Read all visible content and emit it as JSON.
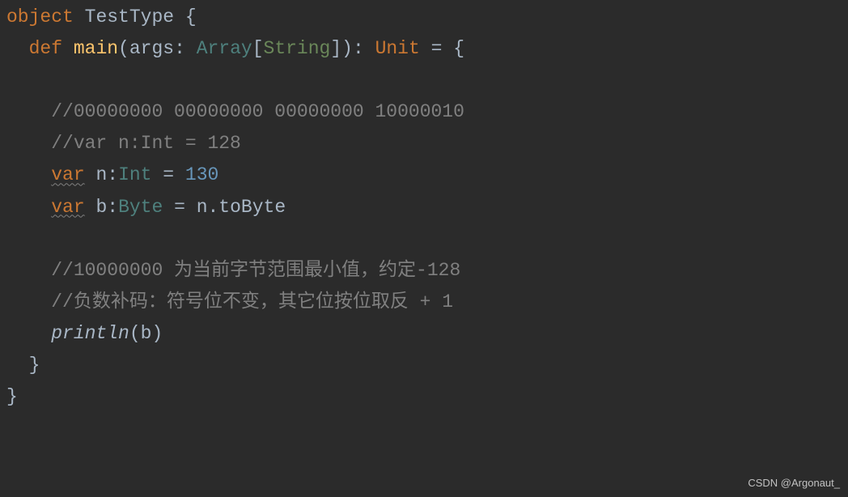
{
  "line1": {
    "keyword": "object",
    "name": "TestType",
    "brace": " {"
  },
  "line2": {
    "indent": "  ",
    "def": "def",
    "name": " main",
    "parenOpen": "(",
    "param": "args",
    "colon": ": ",
    "arrayType": "Array",
    "bracketOpen": "[",
    "stringType": "String",
    "bracketClose": "]",
    "parenClose": ")",
    "retColon": ": ",
    "unitType": "Unit",
    "equals": " = {"
  },
  "line4": {
    "indent": "    ",
    "comment": "//00000000 00000000 00000000 10000010"
  },
  "line5": {
    "indent": "    ",
    "comment": "//var n:Int = 128"
  },
  "line6": {
    "indent": "    ",
    "var": "var",
    "name": " n",
    "colon": ":",
    "type": "Int",
    "equals": " = ",
    "value": "130"
  },
  "line7": {
    "indent": "    ",
    "var": "var",
    "name": " b",
    "colon": ":",
    "type": "Byte",
    "equals": " = ",
    "expr": "n.toByte"
  },
  "line9": {
    "indent": "    ",
    "comment": "//10000000 为当前字节范围最小值，约定-128"
  },
  "line10": {
    "indent": "    ",
    "comment": "//负数补码：符号位不变，其它位按位取反 + 1"
  },
  "line11": {
    "indent": "    ",
    "func": "println",
    "parenOpen": "(",
    "arg": "b",
    "parenClose": ")"
  },
  "line12": {
    "indent": "  ",
    "brace": "}"
  },
  "line13": {
    "brace": "}"
  },
  "watermark": "CSDN @Argonaut_"
}
